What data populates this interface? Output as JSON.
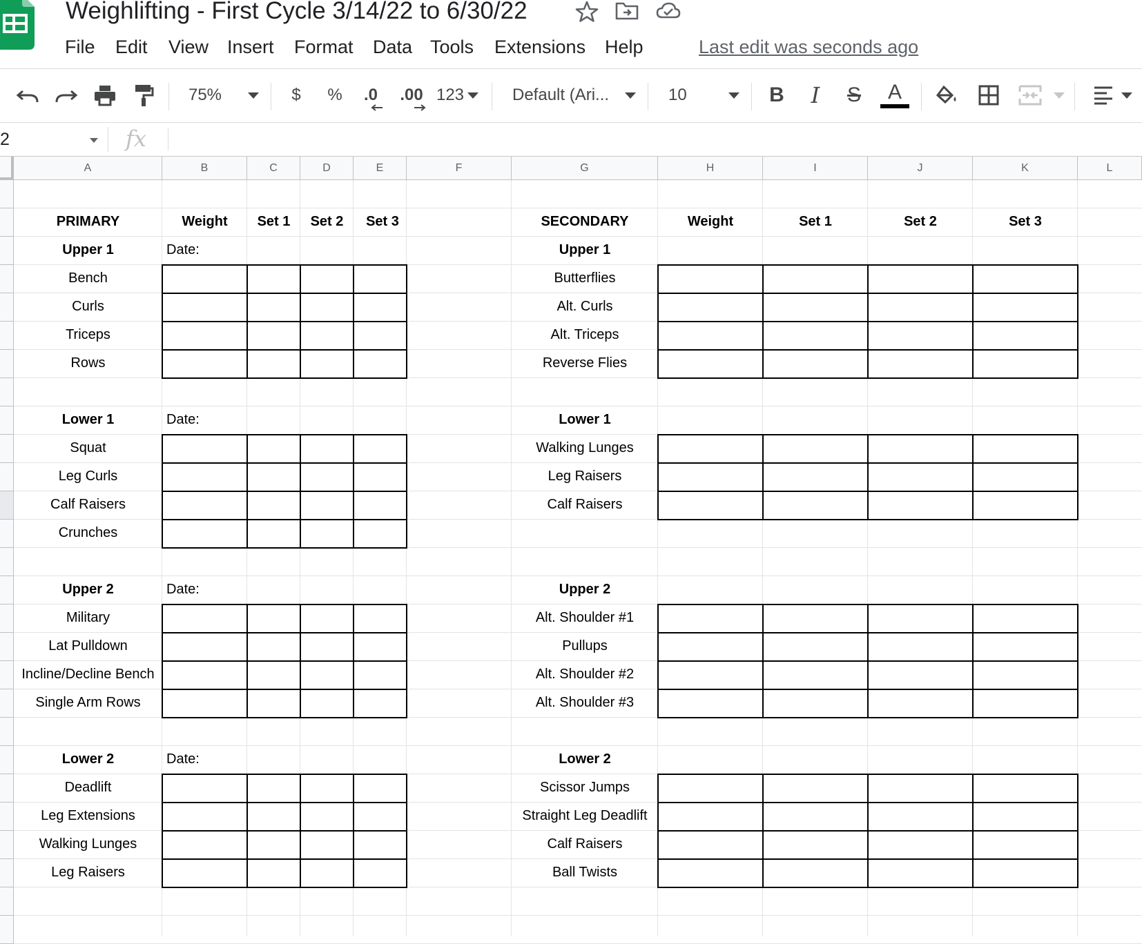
{
  "app": {
    "title": "Weighlifting - First Cycle 3/14/22 to 6/30/22",
    "last_edit": "Last edit was seconds ago",
    "brand_color": "#0F9D58"
  },
  "menu": [
    "File",
    "Edit",
    "View",
    "Insert",
    "Format",
    "Data",
    "Tools",
    "Extensions",
    "Help"
  ],
  "toolbar": {
    "zoom": "75%",
    "currency": "$",
    "percent": "%",
    "decrease_decimal": ".0",
    "increase_decimal": ".00",
    "more_formats": "123",
    "font": "Default (Ari...",
    "font_size": "10",
    "bold": "B",
    "italic": "I",
    "strike": "S",
    "text_color": "A"
  },
  "formula_bar": {
    "name_box": "2",
    "fx": "fx",
    "value": ""
  },
  "columns": [
    "A",
    "B",
    "C",
    "D",
    "E",
    "F",
    "G",
    "H",
    "I",
    "J",
    "K",
    "L"
  ],
  "headers": {
    "primary": "PRIMARY",
    "secondary": "SECONDARY",
    "weight": "Weight",
    "set1": "Set 1",
    "set2": "Set 2",
    "set3": "Set 3",
    "date": "Date:"
  },
  "primary_sections": [
    {
      "title": "Upper 1",
      "exercises": [
        "Bench",
        "Curls",
        "Triceps",
        "Rows"
      ]
    },
    {
      "title": "Lower 1",
      "exercises": [
        "Squat",
        "Leg Curls",
        "Calf Raisers",
        "Crunches"
      ]
    },
    {
      "title": "Upper 2",
      "exercises": [
        "Military",
        "Lat Pulldown",
        "Incline/Decline Bench",
        "Single Arm Rows"
      ]
    },
    {
      "title": "Lower 2",
      "exercises": [
        "Deadlift",
        "Leg Extensions",
        "Walking Lunges",
        "Leg Raisers"
      ]
    }
  ],
  "secondary_sections": [
    {
      "title": "Upper 1",
      "exercises": [
        "Butterflies",
        "Alt. Curls",
        "Alt. Triceps",
        "Reverse Flies"
      ]
    },
    {
      "title": "Lower 1",
      "exercises": [
        "Walking Lunges",
        "Leg Raisers",
        "Calf Raisers"
      ]
    },
    {
      "title": "Upper 2",
      "exercises": [
        "Alt. Shoulder #1",
        "Pullups",
        "Alt. Shoulder #2",
        "Alt. Shoulder #3"
      ]
    },
    {
      "title": "Lower 2",
      "exercises": [
        "Scissor Jumps",
        "Straight Leg Deadlift",
        "Calf Raisers",
        "Ball Twists"
      ]
    }
  ]
}
